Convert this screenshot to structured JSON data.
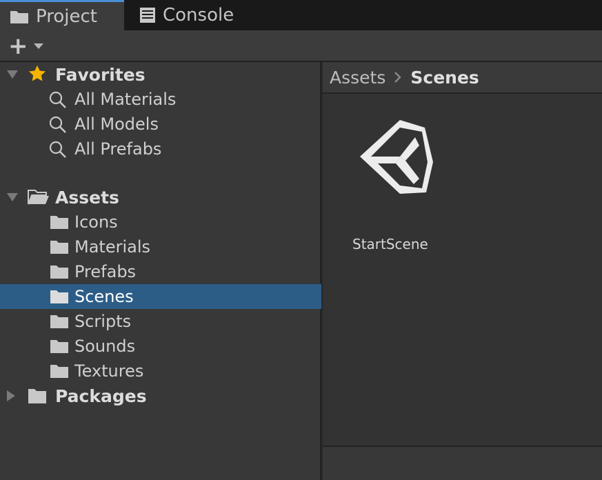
{
  "tabs": [
    {
      "label": "Project",
      "icon": "folder-icon",
      "active": true
    },
    {
      "label": "Console",
      "icon": "console-icon",
      "active": false
    }
  ],
  "toolbar": {
    "add_label": "+"
  },
  "tree": {
    "favorites": {
      "label": "Favorites",
      "items": [
        "All Materials",
        "All Models",
        "All Prefabs"
      ]
    },
    "assets": {
      "label": "Assets",
      "items": [
        "Icons",
        "Materials",
        "Prefabs",
        "Scenes",
        "Scripts",
        "Sounds",
        "Textures"
      ],
      "selected": "Scenes"
    },
    "packages": {
      "label": "Packages"
    }
  },
  "breadcrumb": {
    "root": "Assets",
    "current": "Scenes"
  },
  "content": {
    "assets": [
      {
        "name": "StartScene",
        "icon": "unity-scene-icon"
      }
    ]
  },
  "colors": {
    "selection": "#2c5d87",
    "accent": "#4a8fd6",
    "star": "#f4b400"
  }
}
